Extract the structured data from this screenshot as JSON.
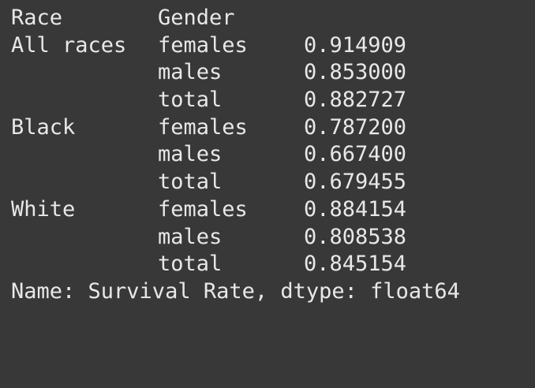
{
  "header": {
    "race_label": "Race",
    "gender_label": "Gender"
  },
  "rows": [
    {
      "race": "All races",
      "gender": "females",
      "value": "0.914909"
    },
    {
      "race": "",
      "gender": "males",
      "value": "0.853000"
    },
    {
      "race": "",
      "gender": "total",
      "value": "0.882727"
    },
    {
      "race": "Black",
      "gender": "females",
      "value": "0.787200"
    },
    {
      "race": "",
      "gender": "males",
      "value": "0.667400"
    },
    {
      "race": "",
      "gender": "total",
      "value": "0.679455"
    },
    {
      "race": "White",
      "gender": "females",
      "value": "0.884154"
    },
    {
      "race": "",
      "gender": "males",
      "value": "0.808538"
    },
    {
      "race": "",
      "gender": "total",
      "value": "0.845154"
    }
  ],
  "footer": "Name: Survival Rate, dtype: float64",
  "colors": {
    "background": "#383838",
    "text": "#e8e8e8"
  }
}
